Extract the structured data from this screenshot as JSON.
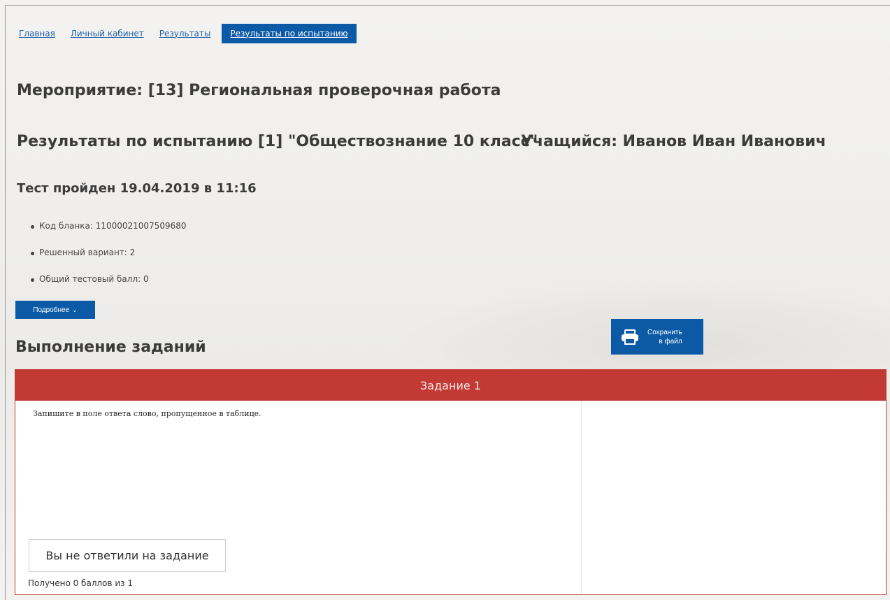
{
  "breadcrumb": {
    "items": [
      "Главная",
      "Личный кабинет",
      "Результаты"
    ],
    "active": "Результаты по испытанию"
  },
  "event_title": "Мероприятие: [13] Региональная проверочная работа",
  "results_title": "Результаты по испытанию [1] \"Обществознание 10 класс\"",
  "student": "Учащийся: Иванов Иван Иванович",
  "passed": "Тест пройден 19.04.2019 в 11:16",
  "info": [
    "Код бланка: 11000021007509680",
    "Решенный вариант: 2",
    "Общий тестовый балл: 0"
  ],
  "more_button": "Подробнее",
  "save_button": {
    "line1": "Сохранить",
    "line2": "в файл"
  },
  "tasks_heading": "Выполнение заданий",
  "task": {
    "header": "Задание 1",
    "question": "Запишите в поле ответа слово, пропущенное в таблице.",
    "answer_status": "Вы не ответили на задание",
    "score": "Получено 0 баллов из 1"
  },
  "colors": {
    "accent_blue": "#0c5aa6",
    "task_red": "#c23a33"
  }
}
